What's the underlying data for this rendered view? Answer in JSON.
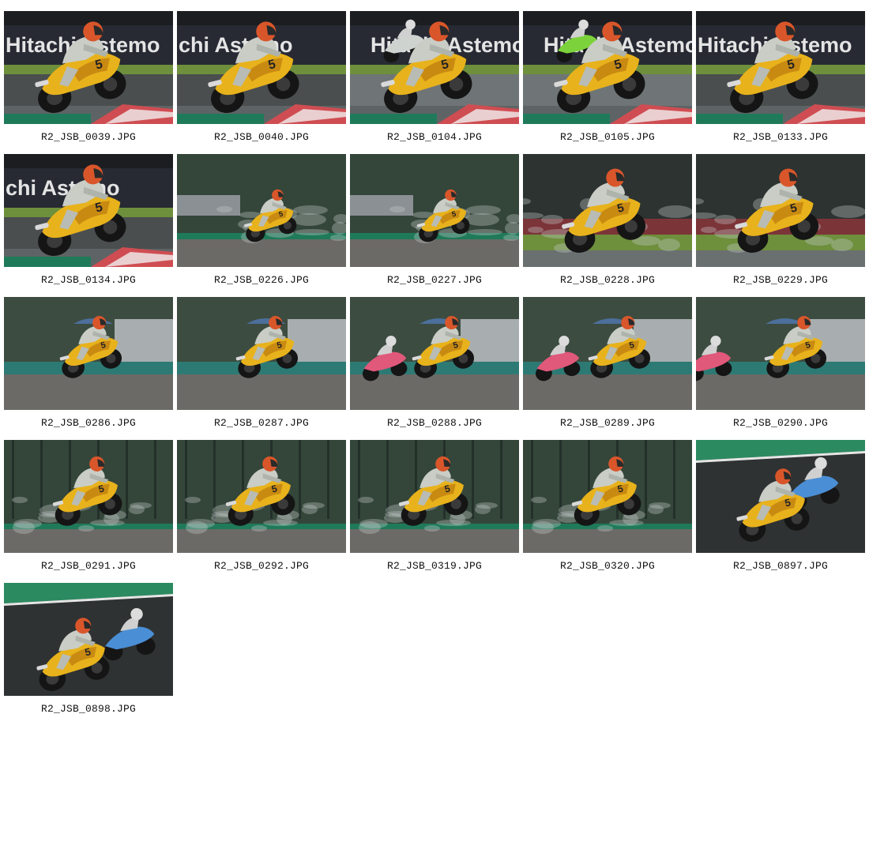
{
  "gallery": {
    "items": [
      {
        "filename": "R2_JSB_0039.JPG",
        "scene": "banner-track",
        "banner_text": "Hitachi Astemo"
      },
      {
        "filename": "R2_JSB_0040.JPG",
        "scene": "banner-track",
        "banner_text": "chi Astemo"
      },
      {
        "filename": "R2_JSB_0104.JPG",
        "scene": "banner-wet",
        "banner_text": "Hitachi Astemo"
      },
      {
        "filename": "R2_JSB_0105.JPG",
        "scene": "banner-wet",
        "banner_text": "Hitachi Astemo"
      },
      {
        "filename": "R2_JSB_0133.JPG",
        "scene": "banner-track",
        "banner_text": "Hitachi Astemo"
      },
      {
        "filename": "R2_JSB_0134.JPG",
        "scene": "banner-track",
        "banner_text": "chi Astemo"
      },
      {
        "filename": "R2_JSB_0226.JPG",
        "scene": "forest-spray",
        "banner_text": ""
      },
      {
        "filename": "R2_JSB_0227.JPG",
        "scene": "forest-spray",
        "banner_text": ""
      },
      {
        "filename": "R2_JSB_0228.JPG",
        "scene": "closeup-wet",
        "banner_text": ""
      },
      {
        "filename": "R2_JSB_0229.JPG",
        "scene": "closeup-wet",
        "banner_text": ""
      },
      {
        "filename": "R2_JSB_0286.JPG",
        "scene": "grandstand-gravel",
        "banner_text": ""
      },
      {
        "filename": "R2_JSB_0287.JPG",
        "scene": "grandstand-gravel",
        "banner_text": ""
      },
      {
        "filename": "R2_JSB_0288.JPG",
        "scene": "grandstand-gravel",
        "banner_text": ""
      },
      {
        "filename": "R2_JSB_0289.JPG",
        "scene": "grandstand-gravel",
        "banner_text": ""
      },
      {
        "filename": "R2_JSB_0290.JPG",
        "scene": "grandstand-gravel",
        "banner_text": ""
      },
      {
        "filename": "R2_JSB_0291.JPG",
        "scene": "forest-gravel",
        "banner_text": ""
      },
      {
        "filename": "R2_JSB_0292.JPG",
        "scene": "forest-gravel",
        "banner_text": ""
      },
      {
        "filename": "R2_JSB_0319.JPG",
        "scene": "forest-gravel",
        "banner_text": ""
      },
      {
        "filename": "R2_JSB_0320.JPG",
        "scene": "forest-gravel",
        "banner_text": ""
      },
      {
        "filename": "R2_JSB_0897.JPG",
        "scene": "asphalt-duo",
        "banner_text": ""
      },
      {
        "filename": "R2_JSB_0898.JPG",
        "scene": "asphalt-duo",
        "banner_text": ""
      }
    ]
  },
  "colors": {
    "bike_yellow": "#e8b21c",
    "helmet_orange": "#d9562a",
    "rider_suit": "#c9cdc6",
    "asphalt_dry": "#2f3232",
    "asphalt_wet": "#5e6465",
    "grass": "#6e8f3c",
    "banner_bg": "#272a33",
    "forest": "#34463a",
    "gravel": "#6c6a66",
    "track_green": "#1f7a5a"
  }
}
